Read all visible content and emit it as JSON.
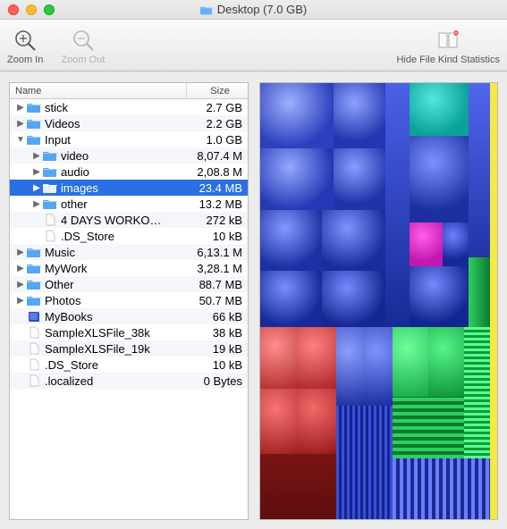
{
  "window": {
    "title": "Desktop (7.0 GB)"
  },
  "toolbar": {
    "zoom_in": "Zoom In",
    "zoom_out": "Zoom Out",
    "hide_stats": "Hide File Kind Statistics"
  },
  "columns": {
    "name": "Name",
    "size": "Size"
  },
  "rows": [
    {
      "indent": 0,
      "disc": "▶",
      "icon": "folder",
      "label": "stick",
      "size": "2.7 GB",
      "selected": false
    },
    {
      "indent": 0,
      "disc": "▶",
      "icon": "folder",
      "label": "Videos",
      "size": "2.2 GB",
      "selected": false
    },
    {
      "indent": 0,
      "disc": "▼",
      "icon": "folder",
      "label": "Input",
      "size": "1.0 GB",
      "selected": false
    },
    {
      "indent": 1,
      "disc": "▶",
      "icon": "folder",
      "label": "video",
      "size": "8,07.4 M",
      "selected": false
    },
    {
      "indent": 1,
      "disc": "▶",
      "icon": "folder",
      "label": "audio",
      "size": "2,08.8 M",
      "selected": false
    },
    {
      "indent": 1,
      "disc": "▶",
      "icon": "folder",
      "label": "images",
      "size": "23.4 MB",
      "selected": true
    },
    {
      "indent": 1,
      "disc": "▶",
      "icon": "folder",
      "label": "other",
      "size": "13.2 MB",
      "selected": false
    },
    {
      "indent": 1,
      "disc": "",
      "icon": "file",
      "label": "4 DAYS WORKO…",
      "size": "272 kB",
      "selected": false
    },
    {
      "indent": 1,
      "disc": "",
      "icon": "file",
      "label": ".DS_Store",
      "size": "10 kB",
      "selected": false
    },
    {
      "indent": 0,
      "disc": "▶",
      "icon": "folder",
      "label": "Music",
      "size": "6,13.1 M",
      "selected": false
    },
    {
      "indent": 0,
      "disc": "▶",
      "icon": "folder",
      "label": "MyWork",
      "size": "3,28.1 M",
      "selected": false
    },
    {
      "indent": 0,
      "disc": "▶",
      "icon": "folder",
      "label": "Other",
      "size": "88.7 MB",
      "selected": false
    },
    {
      "indent": 0,
      "disc": "▶",
      "icon": "folder",
      "label": "Photos",
      "size": "50.7 MB",
      "selected": false
    },
    {
      "indent": 0,
      "disc": "",
      "icon": "book",
      "label": "MyBooks",
      "size": "66 kB",
      "selected": false
    },
    {
      "indent": 0,
      "disc": "",
      "icon": "file",
      "label": "SampleXLSFile_38k",
      "size": "38 kB",
      "selected": false
    },
    {
      "indent": 0,
      "disc": "",
      "icon": "file",
      "label": "SampleXLSFile_19k",
      "size": "19 kB",
      "selected": false
    },
    {
      "indent": 0,
      "disc": "",
      "icon": "file",
      "label": ".DS_Store",
      "size": "10 kB",
      "selected": false
    },
    {
      "indent": 0,
      "disc": "",
      "icon": "file",
      "label": ".localized",
      "size": "0 Bytes",
      "selected": false
    }
  ],
  "colors": {
    "folder": "#53a6f4",
    "folder_sel": "#ffffff",
    "file": "#e8e8e8"
  }
}
